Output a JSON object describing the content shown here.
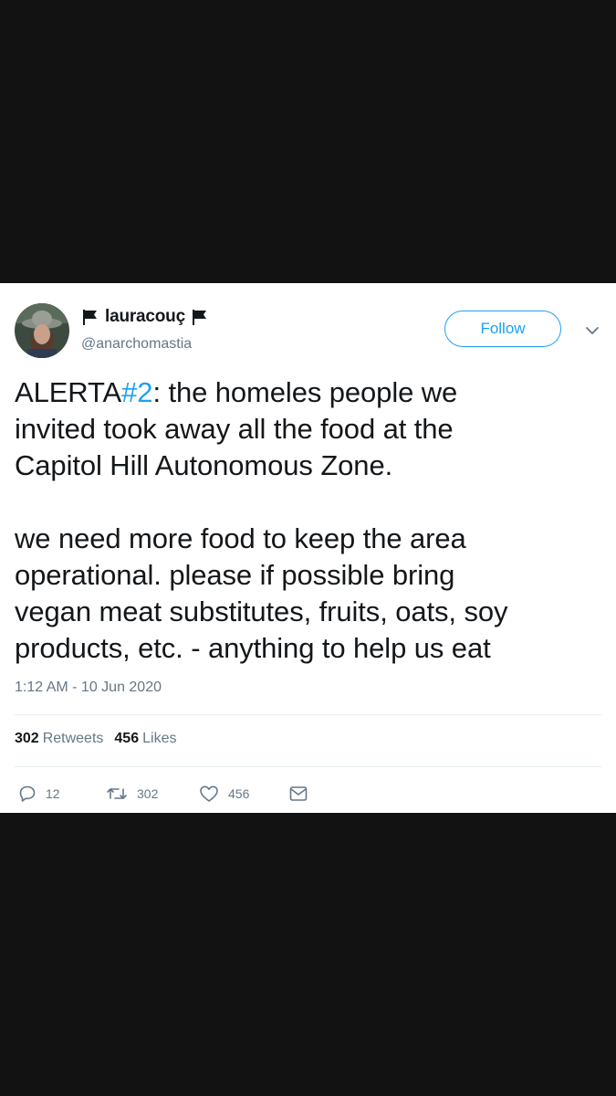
{
  "tweet": {
    "display_name": "lauracouç",
    "handle": "@anarchomastia",
    "follow_label": "Follow",
    "text_segments": {
      "p1_a": "ALERTA",
      "p1_hashtag": "#2",
      "p1_b": ": the homeles people we",
      "p1_line2": "invited took away all the food at the",
      "p1_line3": "Capitol Hill Autonomous Zone.",
      "p2_line1": "we need more food to keep the area",
      "p2_line2": "operational. please if possible bring",
      "p2_line3": "vegan meat substitutes, fruits, oats, soy",
      "p2_line4": "products, etc. - anything to help us eat"
    },
    "timestamp": "1:12 AM - 10 Jun 2020"
  },
  "stats": {
    "retweets_count": "302",
    "retweets_label": "Retweets",
    "likes_count": "456",
    "likes_label": "Likes"
  },
  "actions": {
    "reply_count": "12",
    "retweet_count": "302",
    "like_count": "456"
  },
  "colors": {
    "accent": "#1da1f2",
    "secondary_text": "#657786",
    "primary_text": "#14171a",
    "background": "#121212"
  },
  "icons": [
    "flag-icon",
    "chevron-down-icon",
    "reply-icon",
    "retweet-icon",
    "like-icon",
    "dm-icon"
  ]
}
